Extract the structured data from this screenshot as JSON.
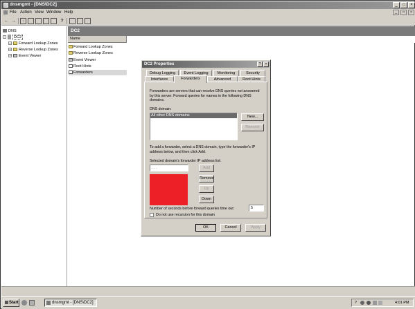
{
  "window": {
    "title": "dnsmgmt - [DNS\\DC2]",
    "controls": [
      "_",
      "□",
      "×"
    ]
  },
  "menubar": {
    "items": [
      "File",
      "Action",
      "View",
      "Window",
      "Help"
    ],
    "mdi_controls": [
      "_",
      "□",
      "×"
    ]
  },
  "toolbar": {
    "buttons": [
      "back-icon",
      "forward-icon",
      "up-icon",
      "console-tree-icon",
      "properties-icon",
      "refresh-icon",
      "export-icon",
      "help-icon",
      "server-icon",
      "list-icon",
      "settings-icon"
    ]
  },
  "tree": {
    "items": [
      {
        "label": "DNS",
        "level": 0
      },
      {
        "label": "DC2",
        "level": 1
      },
      {
        "label": "Forward Lookup Zones",
        "level": 2
      },
      {
        "label": "Reverse Lookup Zones",
        "level": 2
      },
      {
        "label": "Event Viewer",
        "level": 2
      }
    ]
  },
  "content": {
    "header": "DC2",
    "column_name": "Name",
    "items": [
      "Forward Lookup Zones",
      "Reverse Lookup Zones",
      "Event Viewer",
      "Root Hints",
      "Forwarders"
    ]
  },
  "dialog": {
    "title": "DC2 Properties",
    "title_buttons": [
      "?",
      "×"
    ],
    "tabs_row1": [
      "Debug Logging",
      "Event Logging",
      "Monitoring",
      "Security"
    ],
    "tabs_row2": [
      "Interfaces",
      "Forwarders",
      "Advanced",
      "Root Hints"
    ],
    "description": "Forwarders are servers that can resolve DNS queries not answered by this server. Forward queries for names in the following DNS domains.",
    "dns_domain_label": "DNS domain:",
    "dns_domain_items": [
      "All other DNS domains"
    ],
    "new_button": "New...",
    "remove_button": "Remove",
    "add_instruction": "To add a forwarder, select a DNS domain, type the forwarder's IP address below, and then click Add.",
    "ip_list_label": "Selected domain's forwarder IP address list:",
    "ip_input": ". . .",
    "add_button": "Add",
    "remove_ip_button": "Remove",
    "up_button": "Up",
    "down_button": "Down",
    "timeout_label": "Number of seconds before forward queries time out:",
    "timeout_value": "5",
    "recursion_label": "Do not use recursion for this domain",
    "ok_button": "OK",
    "cancel_button": "Cancel",
    "apply_button": "Apply",
    "redacted_color": "#ee2027"
  },
  "taskbar": {
    "start_label": "Start",
    "task_item": "dnsmgmt - [DNS\\DC2]",
    "clock": "4:01 PM"
  }
}
